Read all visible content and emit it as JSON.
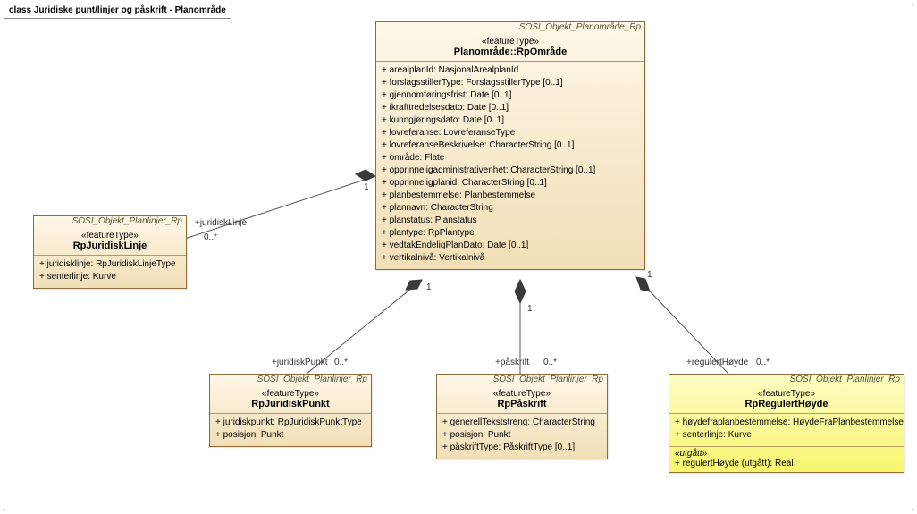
{
  "diagramTitle": "class Juridiske punt/linjer og påskrift - Planområde",
  "planomrade": {
    "pkg": "SOSI_Objekt_Planområde_Rp",
    "stereotype": "«featureType»",
    "name": "Planområde::RpOmråde",
    "attrs": [
      "+   arealplanId: NasjonalArealplanId",
      "+   forslagsstillerType: ForslagsstillerType [0..1]",
      "+   gjennomføringsfrist: Date [0..1]",
      "+   ikrafttredelsesdato: Date [0..1]",
      "+   kunngjøringsdato: Date [0..1]",
      "+   lovreferanse: LovreferanseType",
      "+   lovreferanseBeskrivelse: CharacterString [0..1]",
      "+   område: Flate",
      "+   opprinneligadministrativenhet: CharacterString [0..1]",
      "+   opprinneligplanid: CharacterString [0..1]",
      "+   planbestemmelse: Planbestemmelse",
      "+   plannavn: CharacterString",
      "+   planstatus: Planstatus",
      "+   plantype: RpPlantype",
      "+   vedtakEndeligPlanDato: Date [0..1]",
      "+   vertikalnivå: Vertikalnivå"
    ]
  },
  "juridiskLinje": {
    "pkg": "SOSI_Objekt_Planlinjer_Rp",
    "stereotype": "«featureType»",
    "name": "RpJuridiskLinje",
    "attrs": [
      "+   juridisklinje: RpJuridiskLinjeType",
      "+   senterlinje: Kurve"
    ]
  },
  "juridiskPunkt": {
    "pkg": "SOSI_Objekt_Planlinjer_Rp",
    "stereotype": "«featureType»",
    "name": "RpJuridiskPunkt",
    "attrs": [
      "+   juridiskpunkt: RpJuridiskPunktType",
      "+   posisjon: Punkt"
    ]
  },
  "paskrift": {
    "pkg": "SOSI_Objekt_Planlinjer_Rp",
    "stereotype": "«featureType»",
    "name": "RpPåskrift",
    "attrs": [
      "+   generellTekststreng: CharacterString",
      "+   posisjon: Punkt",
      "+   påskriftType: PåskriftType [0..1]"
    ]
  },
  "regulertHoyde": {
    "pkg": "SOSI_Objekt_Planlinjer_Rp",
    "stereotype": "«featureType»",
    "name": "RpRegulertHøyde",
    "attrs": [
      "+   høydefraplanbestemmelse: HøydeFraPlanbestemmelse",
      "+   senterlinje: Kurve"
    ],
    "utgattHdr": "«utgått»",
    "utgattAttr": "+   regulertHøyde (utgått): Real"
  },
  "assoc": {
    "juridiskLinje": {
      "role": "+juridiskLinje",
      "mult": "0..*",
      "parentMult": "1"
    },
    "juridiskPunkt": {
      "role": "+juridiskPunkt",
      "mult": "0..*",
      "parentMult": "1"
    },
    "paskrift": {
      "role": "+påskrift",
      "mult": "0..*",
      "parentMult": "1"
    },
    "regulertHoyde": {
      "role": "+regulertHøyde",
      "mult": "0..*",
      "parentMult": "1"
    }
  }
}
